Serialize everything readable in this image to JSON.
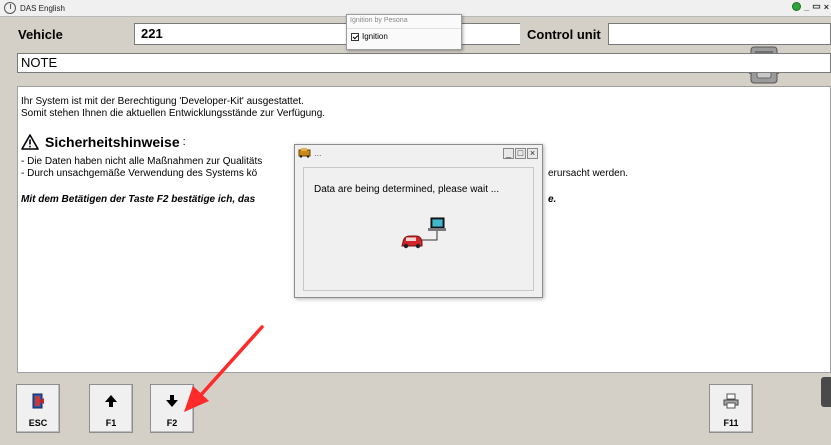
{
  "window": {
    "title": "DAS English",
    "logo_icon": "mercedes-star-icon",
    "status_color": "#2ca53a"
  },
  "vehicle_row": {
    "vehicle_label": "Vehicle",
    "vehicle_value": "221",
    "control_unit_label": "Control unit",
    "control_unit_value": ""
  },
  "note": {
    "label": "NOTE"
  },
  "content": {
    "line1": "Ihr System ist mit der Berechtigung 'Developer-Kit' ausgestattet.",
    "line2": "Somit stehen Ihnen die aktuellen Entwicklungsstände zur Verfügung.",
    "warning_title": "Sicherheitshinweise",
    "warning_colon": ":",
    "bullet1_left": "- Die Daten haben nicht alle Maßnahmen zur Qualitäts",
    "bullet2_left": "- Durch unsachgemäße Verwendung des Systems kö",
    "bullet2_right": "erursacht werden.",
    "confirm_left": "Mit dem Betätigen der Taste F2 bestätige ich, das",
    "confirm_right": "e."
  },
  "ignition_popup": {
    "title": "Ignition by Pesona",
    "checkbox_label": "Ignition",
    "checked": true
  },
  "dialog": {
    "title": "...",
    "message": "Data are being determined, please wait ...",
    "icon": "car-to-laptop-icon"
  },
  "toolbar": {
    "esc_label": "ESC",
    "f1_label": "F1",
    "f2_label": "F2",
    "f11_label": "F11"
  },
  "annotation": {
    "arrow_color": "#ff2a2a"
  }
}
